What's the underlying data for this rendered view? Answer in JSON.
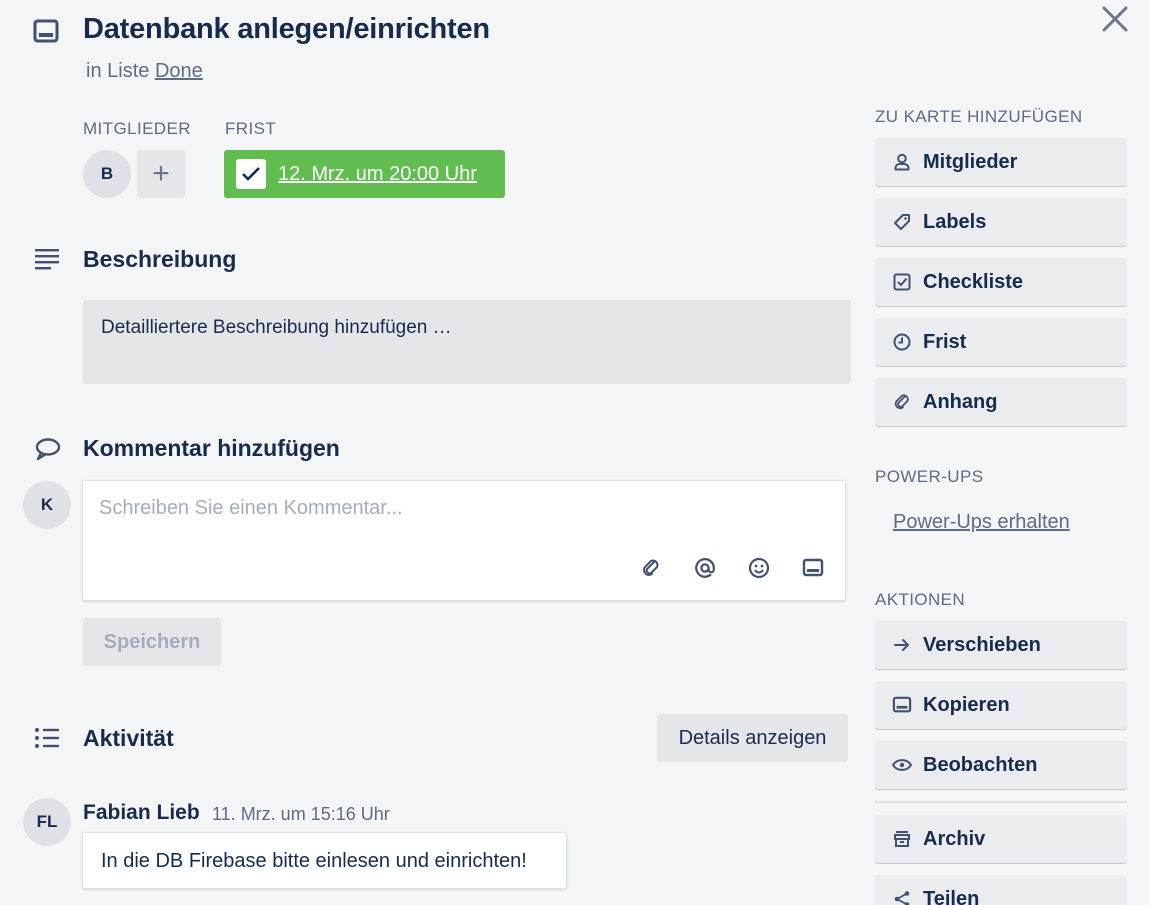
{
  "card": {
    "title": "Datenbank anlegen/einrichten",
    "in_list_prefix": "in Liste",
    "list_name": "Done"
  },
  "members": {
    "label": "Mitglieder",
    "avatar_initials": "B",
    "add_label": "+"
  },
  "due": {
    "label": "Frist",
    "date_text": "12. Mrz. um 20:00 Uhr",
    "checked": true,
    "color": "#61bd4f"
  },
  "description": {
    "heading": "Beschreibung",
    "placeholder": "Detailliertere Beschreibung hinzufügen …"
  },
  "comment": {
    "heading": "Kommentar hinzufügen",
    "user_initials": "K",
    "placeholder": "Schreiben Sie einen Kommentar...",
    "value": "",
    "save_label": "Speichern",
    "tools": [
      "attachment-icon",
      "mention-icon",
      "emoji-icon",
      "card-icon"
    ]
  },
  "activity": {
    "heading": "Aktivität",
    "details_button": "Details anzeigen",
    "entries": [
      {
        "initials": "FL",
        "author": "Fabian Lieb",
        "time": "11. Mrz. um 15:16 Uhr",
        "text": "In die DB Firebase bitte einlesen und einrichten!"
      }
    ]
  },
  "sidebar": {
    "add_to_card_label": "Zu Karte hinzufügen",
    "add_items": [
      {
        "label": "Mitglieder",
        "icon": "person-icon"
      },
      {
        "label": "Labels",
        "icon": "tag-icon"
      },
      {
        "label": "Checkliste",
        "icon": "checklist-icon"
      },
      {
        "label": "Frist",
        "icon": "clock-icon"
      },
      {
        "label": "Anhang",
        "icon": "attachment-icon"
      }
    ],
    "powerups_label": "Power-Ups",
    "powerups_link": "Power-Ups erhalten",
    "actions_label": "Aktionen",
    "action_items": [
      {
        "label": "Verschieben",
        "icon": "arrow-right-icon"
      },
      {
        "label": "Kopieren",
        "icon": "card-icon"
      },
      {
        "label": "Beobachten",
        "icon": "eye-icon"
      }
    ],
    "archive_items": [
      {
        "label": "Archiv",
        "icon": "archive-icon"
      },
      {
        "label": "Teilen",
        "icon": "share-icon"
      }
    ]
  },
  "colors": {
    "text": "#172b4d",
    "muted": "#5e6c84",
    "button_bg": "#eaecf0",
    "page_bg": "#f4f5f7"
  }
}
